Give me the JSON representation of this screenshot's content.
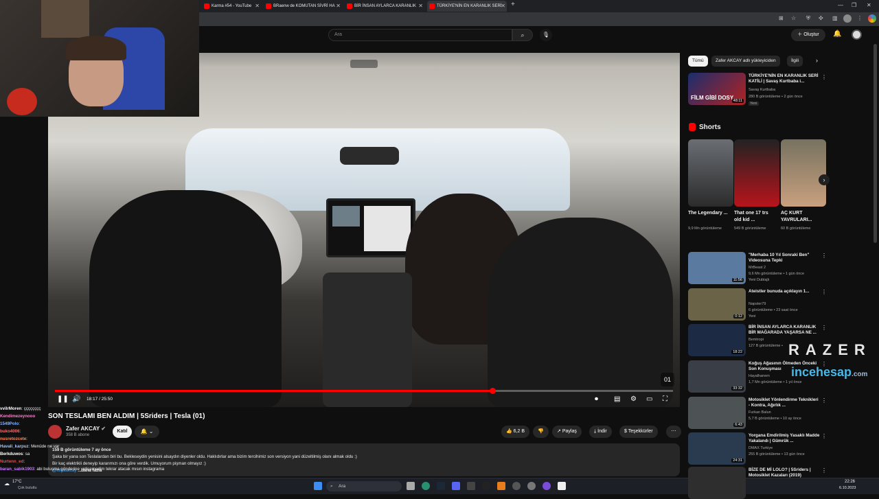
{
  "browser": {
    "tabs": [
      {
        "label": "Karma #54 - YouTube"
      },
      {
        "label": "BRaenw de KOMUTAN SİVRİ HA"
      },
      {
        "label": "BİR İNSAN AYLARCA KARANLIK"
      },
      {
        "label": "TÜRKİYE'NİN EN KARANLIK SERİ"
      }
    ],
    "new_tab": "+"
  },
  "youtube": {
    "search_placeholder": "Ara",
    "create_label": "Oluştur"
  },
  "video": {
    "time": "18:17 / 25:50",
    "progress_fraction": 0.708,
    "title": "SON TESLAMI BEN ALDIM | 5Sriders | Tesla (01)",
    "channel": "Zafer AKCAY",
    "subscribers": "358 B abone",
    "join_label": "Katıl",
    "likes": "6,2 B",
    "share_label": "Paylaş",
    "download_label": "İndir",
    "thanks_label": "Teşekkürler",
    "description": {
      "meta": "159 B görüntüleme  7 ay önce",
      "line1": "Şaka bir yana son Teslalardan biri bu. Bekleseydin yenisini alsaydın diyenler oldu. Haklıdırlar ama bizim tercihimiz son versiyon yani düzeltilmiş olanı almak oldu :)",
      "line2": "Bir kaç elektrikli deneyip kararımızı ona göre verdik. Umuyorum pişman olmayız :)",
      "line3": "@fulyaakcay",
      "more": "...daha fazla"
    }
  },
  "chat": [
    {
      "name": "vvilrMoren",
      "text": ": çççççççç"
    },
    {
      "name": "Kendimezeynooo",
      "text": ""
    },
    {
      "name": "1549Polo",
      "text": ":"
    },
    {
      "name": "buko4006",
      "text": ":"
    },
    {
      "name": "nusretozcete",
      "text": ":"
    },
    {
      "name": "Havali_karpuz",
      "text": ": Menüde ne var"
    },
    {
      "name": "Berkduwos",
      "text": ": sa"
    },
    {
      "name": "Nurtenn_ed",
      "text": ":"
    },
    {
      "name": "baran_sabik1903",
      "text": ": abi buluşma gönderine yetişemedim tekrar atacak mısın instagrama"
    }
  ],
  "sidebar": {
    "chips": [
      {
        "label": "Tümü",
        "active": true
      },
      {
        "label": "Zafer AKCAY adlı yükleyiciden",
        "active": false
      },
      {
        "label": "İlgili",
        "active": false
      }
    ],
    "first": {
      "title": "TÜRKİYE'NİN EN KARANLIK SERİ KATİLİ | Savaş Kurtbaba i...",
      "channel": "Savaş Kurtbaba",
      "meta": "280 B görüntüleme • 2 gün önce",
      "badge": "Yeni",
      "duration": "48:11",
      "thumb_text": "FİLM GİBİ DOSY"
    },
    "shorts_header": "Shorts",
    "shorts": [
      {
        "title": "The Legendary ...",
        "views": "9,9 Mn görüntüleme"
      },
      {
        "title": "That one 17 trs old kid ...",
        "views": "549 B görüntüleme"
      },
      {
        "title": "AÇ KURT YAVRULARI...",
        "views": "60 B görüntüleme"
      }
    ],
    "videos": [
      {
        "title": "\"Merhaba 10 Yıl Sonraki Ben\" Videosuna Tepki",
        "channel": "MrBeast 2",
        "meta": "9,6 Mn görüntüleme • 1 gün önce",
        "badges": "Yeni  Dublajlı",
        "duration": "11:56",
        "color": "#5a7aa0"
      },
      {
        "title": "Ateistler bunuda açıklayın 1...",
        "channel": "Napster79",
        "meta": "6 görüntüleme • 23 saat önce",
        "badges": "Yeni",
        "duration": "0:12",
        "color": "#6b6348"
      },
      {
        "title": "BİR İNSAN AYLARCA KARANLIK BİR MAĞARADA YAŞARSA NE ...",
        "channel": "Bemtropi",
        "meta": "127 B görüntüleme •",
        "badges": "",
        "duration": "18:22",
        "color": "#1d2a44"
      },
      {
        "title": "Koğuş Ağasının Ölmeden Önceki Son Konuşması",
        "channel": "Hayalhanem",
        "meta": "1,7 Mn görüntüleme • 1 yıl önce",
        "badges": "",
        "duration": "33:32",
        "color": "#3a3e46"
      },
      {
        "title": "Motosiklet Yönlendirme Teknikleri - Kontra, Ağırlık ...",
        "channel": "Furkan Balun",
        "meta": "5,7 B görüntüleme • 10 ay önce",
        "badges": "",
        "duration": "6:43",
        "color": "#4d5254"
      },
      {
        "title": "Yorgana Emdirilmiş Yasaklı Madde Yakalandı | Gümrük ...",
        "channel": "DMAX Turkiye",
        "meta": "255 B görüntüleme • 13 gün önce",
        "badges": "",
        "duration": "24:31",
        "color": "#2a3b4f"
      },
      {
        "title": "BİZE DE Mİ LOLO? | 5Sriders | Motosiklet Kazaları (2019)",
        "channel": "",
        "meta": "",
        "badges": "",
        "duration": "",
        "color": "#2e2e2e"
      }
    ]
  },
  "watermark": {
    "brand": "RAZER",
    "site": "incehesap",
    "tld": ".com"
  },
  "taskbar": {
    "weather_temp": "17°C",
    "weather_desc": "Çok bulutlu",
    "search": "Ara",
    "time": "22:26",
    "date": "6.10.2023"
  },
  "colors": {
    "youtube_red": "#ff0000",
    "background": "#0f0f0f"
  }
}
